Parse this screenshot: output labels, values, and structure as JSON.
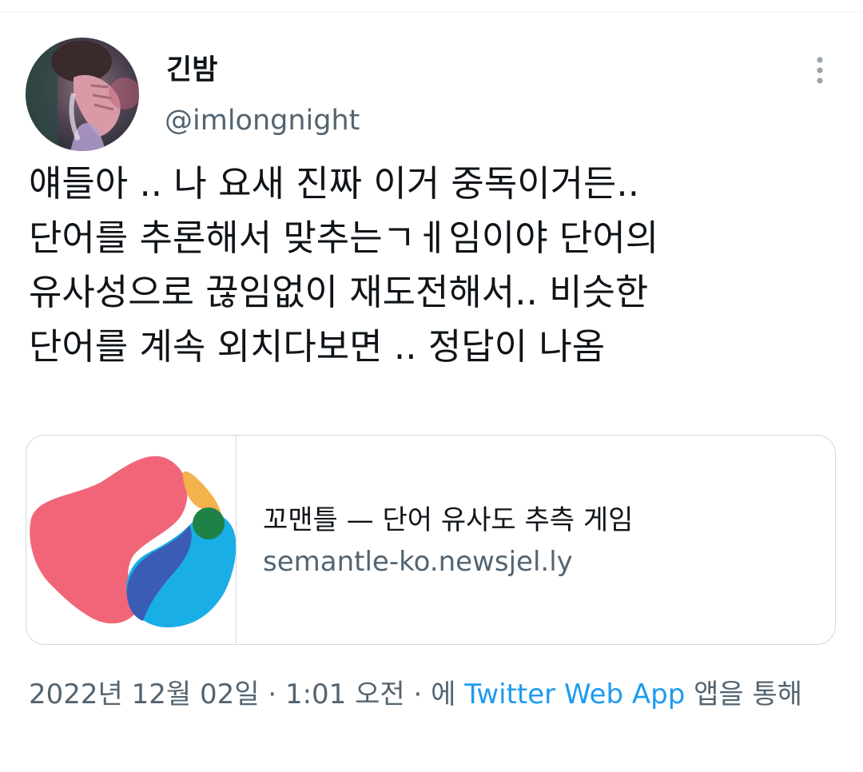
{
  "author": {
    "display_name": "긴밤",
    "handle": "@imlongnight"
  },
  "tweet": {
    "lines": [
      "얘들아 .. 나 요새 진짜 이거 중독이거든..",
      "단어를 추론해서 맞추는ㄱㅔ임이야 단어의",
      "유사성으로 끊임없이 재도전해서.. 비슷한",
      "단어를 계속 외치다보면 .. 정답이 나옴"
    ]
  },
  "card": {
    "title": "꼬맨틀 — 단어 유사도 추측 게임",
    "domain": "semantle-ko.newsjel.ly"
  },
  "meta": {
    "date": "2022년 12월 02일",
    "separator_1": " · ",
    "time": "1:01 오전",
    "separator_2": " · ",
    "via_prefix": "에 ",
    "source": "Twitter Web App",
    "via_suffix": " 앱을 통해"
  },
  "colors": {
    "link": "#1d9bf0",
    "secondary_text": "#536471",
    "logo_pink": "#f06578",
    "logo_yellow": "#f3b24c",
    "logo_blue": "#1aaee6",
    "logo_navy": "#3a5cb5",
    "logo_green": "#1e8246"
  },
  "icons": {
    "more": "vertical-ellipsis-icon",
    "logo": "semantle-logo"
  }
}
